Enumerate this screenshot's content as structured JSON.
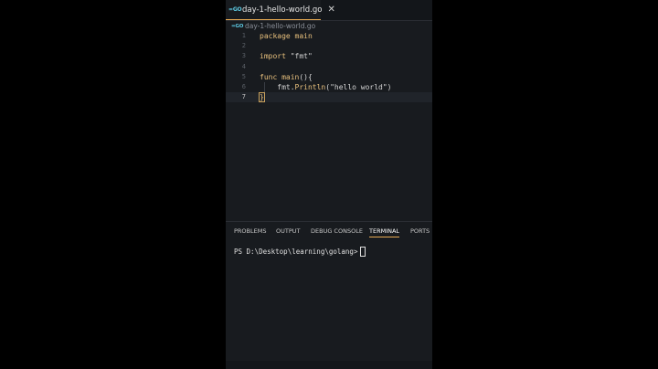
{
  "tab": {
    "icon": "go-file-icon",
    "label": "day-1-hello-world.go",
    "close": "✕"
  },
  "breadcrumb": {
    "file": "day-1-hello-world.go"
  },
  "editor": {
    "lines": [
      {
        "n": "1",
        "segments": [
          {
            "cls": "kw",
            "t": "package "
          },
          {
            "cls": "fn",
            "t": "main"
          }
        ]
      },
      {
        "n": "2",
        "segments": []
      },
      {
        "n": "3",
        "segments": [
          {
            "cls": "kw",
            "t": "import "
          },
          {
            "cls": "str",
            "t": "\"fmt\""
          }
        ]
      },
      {
        "n": "4",
        "segments": []
      },
      {
        "n": "5",
        "segments": [
          {
            "cls": "kw",
            "t": "func "
          },
          {
            "cls": "fn",
            "t": "main"
          },
          {
            "cls": "",
            "t": "(){"
          }
        ]
      },
      {
        "n": "6",
        "segments": [
          {
            "cls": "",
            "t": "    fmt."
          },
          {
            "cls": "fn",
            "t": "Println"
          },
          {
            "cls": "",
            "t": "(\"hello world\")"
          }
        ]
      },
      {
        "n": "7",
        "segments": [
          {
            "cls": "brace-hl",
            "t": "}"
          }
        ]
      }
    ]
  },
  "panel": {
    "tabs": [
      "PROBLEMS",
      "OUTPUT",
      "DEBUG CONSOLE",
      "TERMINAL",
      "PORTS"
    ],
    "active": "TERMINAL"
  },
  "terminal": {
    "prompt": "PS D:\\Desktop\\learning\\golang>"
  }
}
